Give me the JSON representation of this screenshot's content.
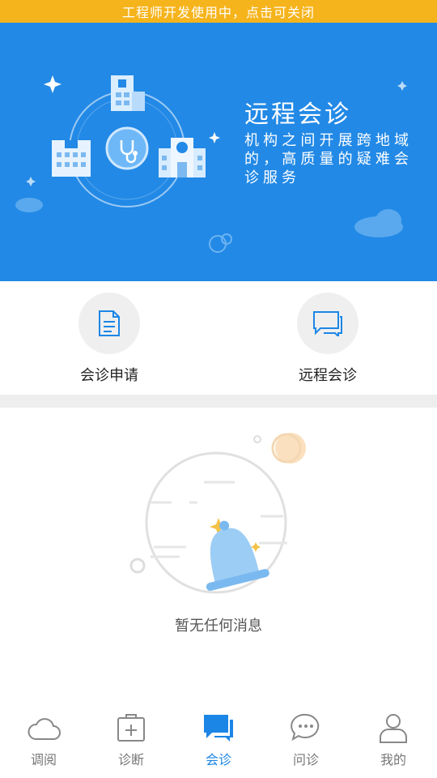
{
  "dev_bar": {
    "text": "工程师开发使用中，点击可关闭"
  },
  "banner": {
    "title": "远程会诊",
    "description": "机构之间开展跨地域的，高质量的疑难会诊服务"
  },
  "actions": [
    {
      "label": "会诊申请",
      "icon": "document-icon"
    },
    {
      "label": "远程会诊",
      "icon": "chat-icon"
    }
  ],
  "empty_state": {
    "text": "暂无任何消息",
    "icon": "bell-icon"
  },
  "tabbar": {
    "active_index": 2,
    "active_color": "#1c86e6",
    "items": [
      {
        "label": "调阅",
        "icon": "cloud-icon"
      },
      {
        "label": "诊断",
        "icon": "medical-kit-icon"
      },
      {
        "label": "会诊",
        "icon": "chat-bubbles-icon"
      },
      {
        "label": "问诊",
        "icon": "message-dots-icon"
      },
      {
        "label": "我的",
        "icon": "user-icon"
      }
    ]
  },
  "colors": {
    "banner": "#2289e6",
    "dev_bar": "#f6b41c",
    "divider": "#eeeeee"
  }
}
